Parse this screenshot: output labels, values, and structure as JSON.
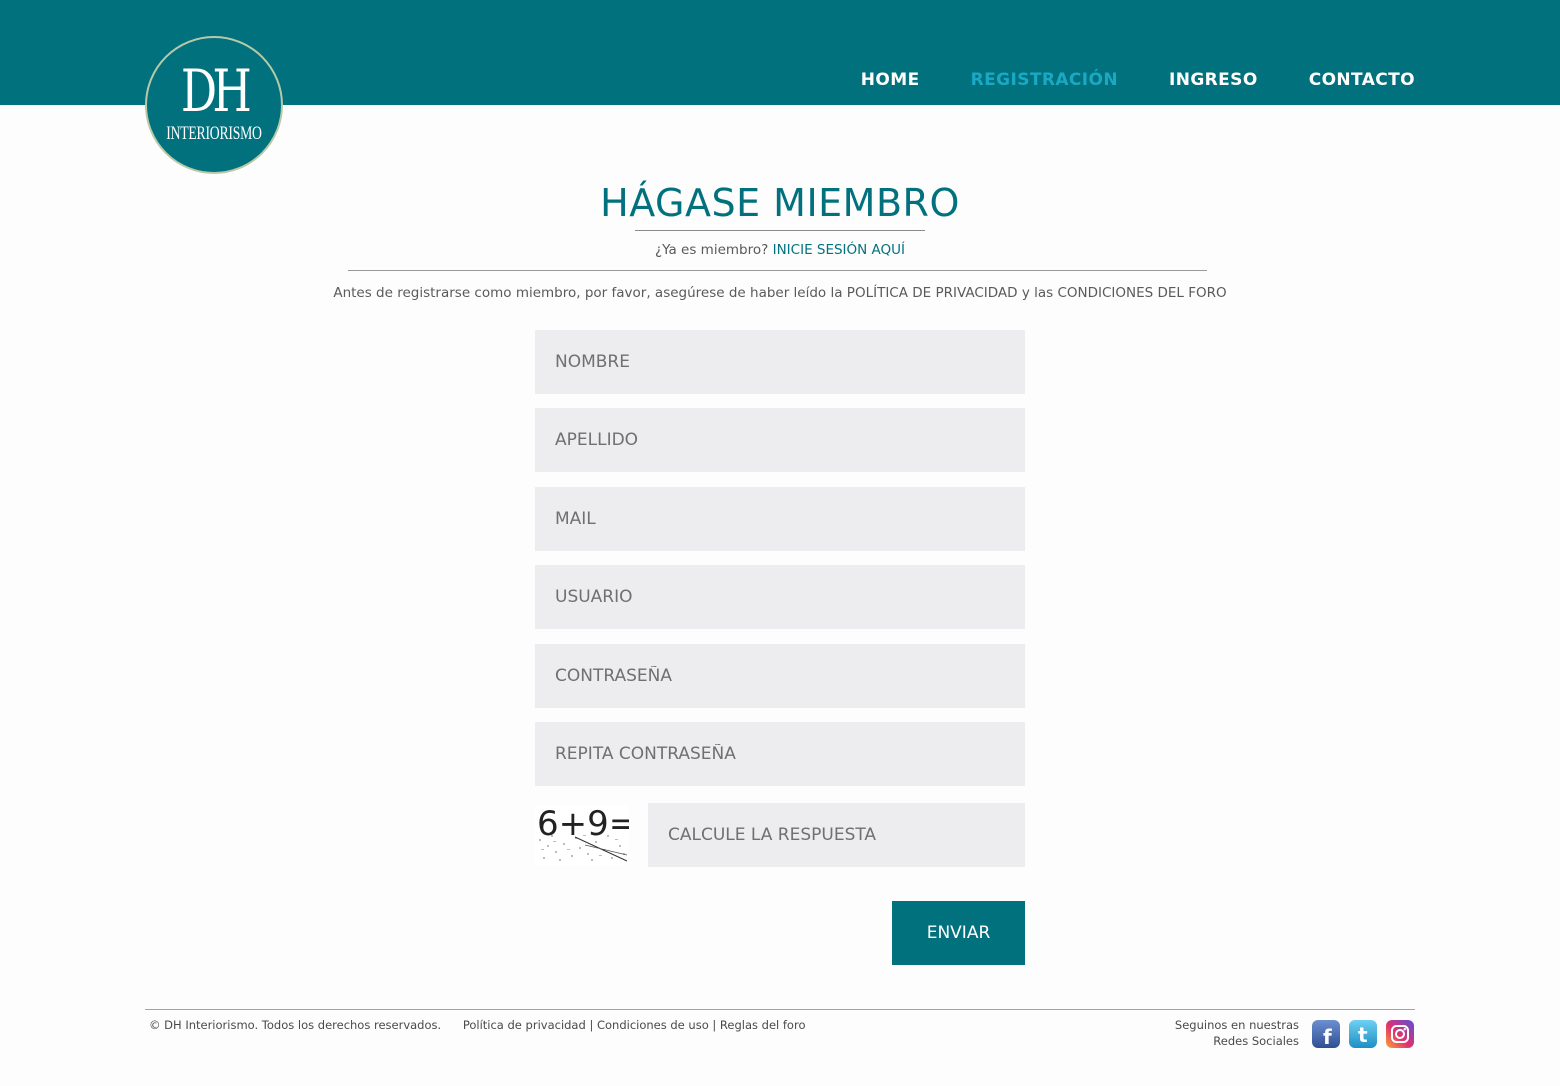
{
  "brand": {
    "logo_mark": "DH",
    "logo_sub": "INTERIORISMO"
  },
  "nav": [
    {
      "label": "HOME",
      "active": false
    },
    {
      "label": "REGISTRACIÓN",
      "active": true
    },
    {
      "label": "INGRESO",
      "active": false
    },
    {
      "label": "CONTACTO",
      "active": false
    }
  ],
  "page": {
    "title": "HÁGASE MIEMBRO",
    "login_prompt": "¿Ya es miembro?",
    "login_link": "INICIE SESIÓN AQUÍ",
    "notice": "Antes de registrarse como miembro, por favor, asegúrese de haber leído la POLÍTICA DE PRIVACIDAD y las CONDICIONES DEL FORO"
  },
  "form": {
    "fields": [
      {
        "placeholder": "NOMBRE",
        "value": ""
      },
      {
        "placeholder": "APELLIDO",
        "value": ""
      },
      {
        "placeholder": "MAIL",
        "value": ""
      },
      {
        "placeholder": "USUARIO",
        "value": ""
      },
      {
        "placeholder": "CONTRASEÑA",
        "value": ""
      },
      {
        "placeholder": "REPITA CONTRASEÑA",
        "value": ""
      }
    ],
    "captcha_text": "6+9=",
    "captcha_placeholder": "CALCULE LA RESPUESTA",
    "submit_label": "ENVIAR"
  },
  "footer": {
    "copyright": "© DH Interiorismo. Todos los derechos reservados.",
    "links": [
      "Política de privacidad",
      "Condiciones de uso",
      "Reglas del foro"
    ],
    "separator": "|",
    "social_line1": "Seguinos en nuestras",
    "social_line2": "Redes Sociales",
    "social": [
      {
        "name": "facebook",
        "glyph": "f",
        "color": "#3b5998"
      },
      {
        "name": "twitter",
        "glyph": "t",
        "color": "#2aa3d8"
      },
      {
        "name": "instagram",
        "glyph": "",
        "color": "#c13584"
      }
    ]
  },
  "colors": {
    "primary": "#02717e",
    "nav_active": "#1aa9c4",
    "field_bg": "#edecee"
  }
}
